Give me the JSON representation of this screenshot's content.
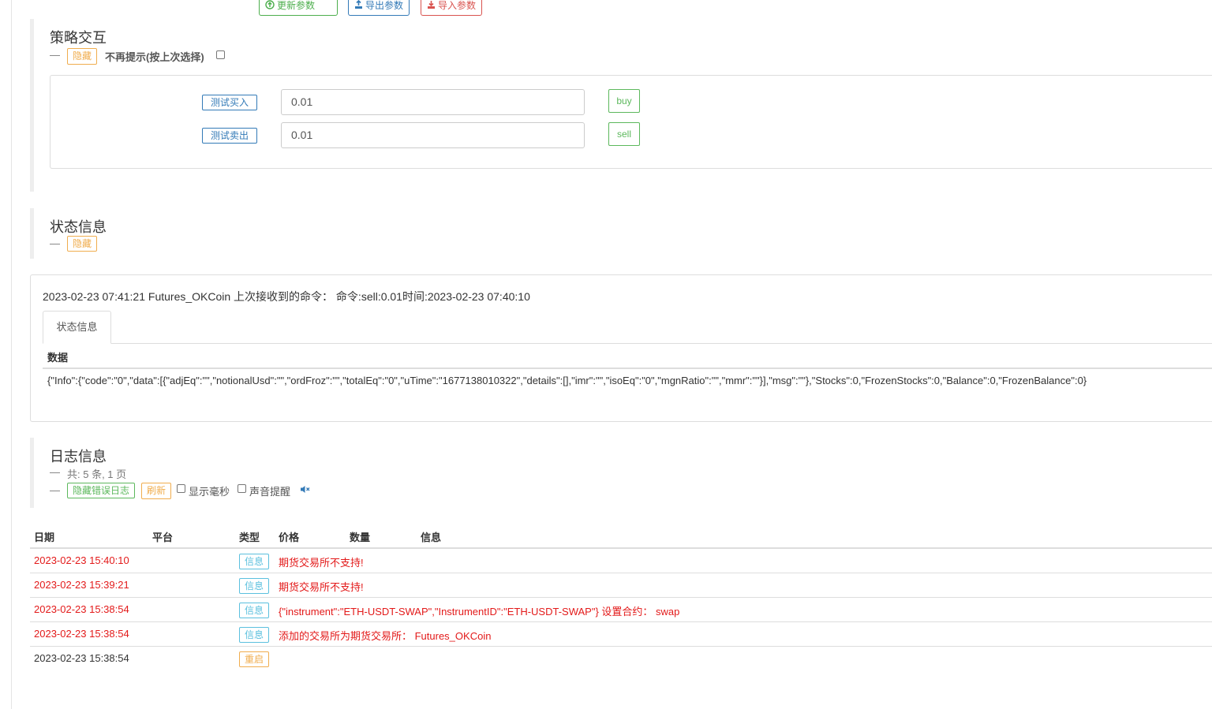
{
  "toolbar": {
    "update_params": "更新参数",
    "export_params": "导出参数",
    "import_params": "导入参数"
  },
  "strategy": {
    "title": "策略交互",
    "dash": "—",
    "hide_label": "隐藏",
    "no_prompt_label": "不再提示(按上次选择)",
    "rows": [
      {
        "label": "测试买入",
        "value": "0.01",
        "action": "buy"
      },
      {
        "label": "测试卖出",
        "value": "0.01",
        "action": "sell"
      }
    ]
  },
  "status": {
    "title": "状态信息",
    "dash": "—",
    "hide_label": "隐藏",
    "summary": "2023-02-23 07:41:21 Futures_OKCoin 上次接收到的命令： 命令:sell:0.01时间:2023-02-23 07:40:10",
    "tab_label": "状态信息",
    "data_header": "数据",
    "data_value": "{\"Info\":{\"code\":\"0\",\"data\":[{\"adjEq\":\"\",\"notionalUsd\":\"\",\"ordFroz\":\"\",\"totalEq\":\"0\",\"uTime\":\"1677138010322\",\"details\":[],\"imr\":\"\",\"isoEq\":\"0\",\"mgnRatio\":\"\",\"mmr\":\"\"}],\"msg\":\"\"},\"Stocks\":0,\"FrozenStocks\":0,\"Balance\":0,\"FrozenBalance\":0}"
  },
  "log": {
    "title": "日志信息",
    "dash": "—",
    "count_text": "共: 5 条, 1 页",
    "hide_error_label": "隐藏错误日志",
    "refresh_label": "刷新",
    "show_ms_label": "显示毫秒",
    "sound_label": "声音提醒",
    "columns": {
      "date": "日期",
      "platform": "平台",
      "type": "类型",
      "price": "价格",
      "amount": "数量",
      "info": "信息"
    },
    "rows": [
      {
        "date": "2023-02-23 15:40:10",
        "type": "信息",
        "message": "期货交易所不支持!"
      },
      {
        "date": "2023-02-23 15:39:21",
        "type": "信息",
        "message": "期货交易所不支持!"
      },
      {
        "date": "2023-02-23 15:38:54",
        "type": "信息",
        "message": "{\"instrument\":\"ETH-USDT-SWAP\",\"InstrumentID\":\"ETH-USDT-SWAP\"} 设置合约： swap"
      },
      {
        "date": "2023-02-23 15:38:54",
        "type": "信息",
        "message": "添加的交易所为期货交易所： Futures_OKCoin"
      },
      {
        "date": "2023-02-23 15:38:54",
        "type": "重启",
        "message": ""
      }
    ]
  },
  "colors": {
    "error_text": "#e31a1a",
    "success": "#5cb85c",
    "warning": "#f0ad4e",
    "primary": "#337ab7",
    "info": "#5bc0de"
  }
}
